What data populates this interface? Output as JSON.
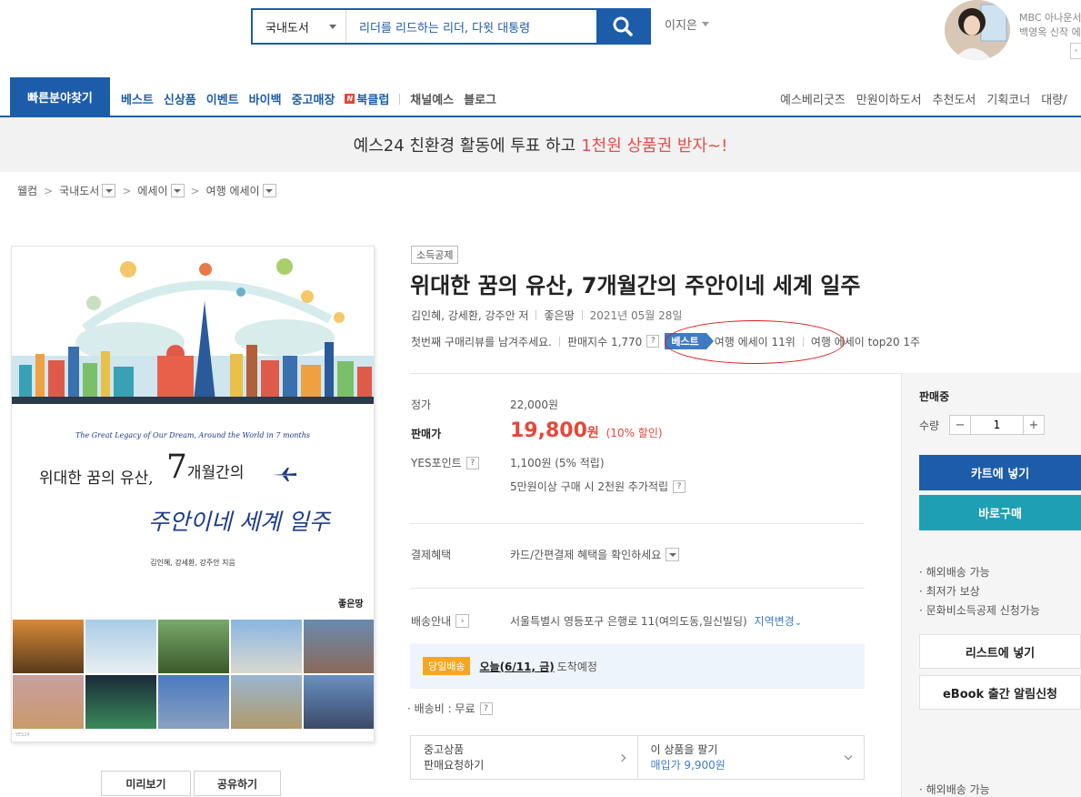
{
  "search": {
    "category": "국내도서",
    "query": "리더를 리드하는 리더, 다윗 대통령",
    "button_icon": "search-icon"
  },
  "user": {
    "name": "이지은"
  },
  "promo": {
    "line1": "MBC 아나운서",
    "line2": "백영옥 신작 에세"
  },
  "nav": {
    "quick_find": "빠른분야찾기",
    "main": [
      "베스트",
      "신상품",
      "이벤트",
      "바이백",
      "중고매장",
      "북클럽",
      "채널예스",
      "블로그"
    ],
    "bookclub_icon": "N",
    "right": [
      "예스베리굿즈",
      "만원이하도서",
      "추천도서",
      "기획코너",
      "대량/"
    ]
  },
  "banner": {
    "text": "예스24 친환경 활동에 투표 하고",
    "highlight": "1천원 상품권 받자~!"
  },
  "breadcrumb": [
    "웰컴",
    "국내도서",
    "에세이",
    "여행 에세이"
  ],
  "cover": {
    "subtitle": "The Great Legacy of Our Dream, Around the World in 7 months",
    "title_part1": "위대한 꿈의 유산,",
    "seven": "7",
    "title_part1b": "개월간의",
    "title_part2": "주안이네 세계 일주",
    "author_line": "김인혜, 강세환, 강주안 지음",
    "publisher": "좋은땅",
    "tag": "YES24"
  },
  "book": {
    "badge": "소득공제",
    "title": "위대한 꿈의 유산, 7개월간의 주안이네 세계 일주",
    "authors": "김인혜, 강세환, 강주안 저",
    "publisher": "좋은땅",
    "date": "2021년 05월 28일",
    "review_prompt": "첫번째 구매리뷰를 남겨주세요.",
    "sales_index": "판매지수 1,770",
    "best_label": "베스트",
    "rank1": "여행 에세이 11위",
    "rank2": "여행 에세이 top20 1주"
  },
  "price": {
    "list_label": "정가",
    "list_value": "22,000원",
    "sale_label": "판매가",
    "sale_value": "19,800",
    "sale_unit": "원",
    "discount": "(10% 할인)",
    "points_label": "YES포인트",
    "points_value": "1,100원 (5% 적립)",
    "extra_points": "5만원이상 구매 시 2천원 추가적립"
  },
  "payment": {
    "label": "결제혜택",
    "value": "카드/간편결제 혜택을 확인하세요"
  },
  "delivery": {
    "label": "배송안내",
    "address": "서울특별시 영등포구 은행로 11(여의도동,일신빌딩)",
    "change": "지역변경",
    "today_tag": "당일배송",
    "date": "오늘(6/11, 금)",
    "arrive": "도착예정",
    "fee": "· 배송비 : 무료"
  },
  "used": {
    "left_line1": "중고상품",
    "left_line2": "판매요청하기",
    "right_line1": "이 상품을 팔기",
    "right_line2": "매입가 9,900원"
  },
  "panel": {
    "status": "판매중",
    "qty_label": "수량",
    "qty": "1",
    "cart": "카트에 넣기",
    "buy": "바로구매",
    "features": [
      "· 해외배송 가능",
      "· 최저가 보상",
      "· 문화비소득공제 신청가능"
    ],
    "wishlist": "리스트에 넣기",
    "ebook_alert": "eBook 출간 알림신청",
    "bottom_feature": "· 해외배송 가능"
  },
  "cover_buttons": {
    "preview": "미리보기",
    "share": "공유하기"
  },
  "colors": {
    "brand": "#1d5ca8",
    "price": "#e8463a",
    "buy": "#1e9fb2",
    "best": "#3d7bc4"
  }
}
